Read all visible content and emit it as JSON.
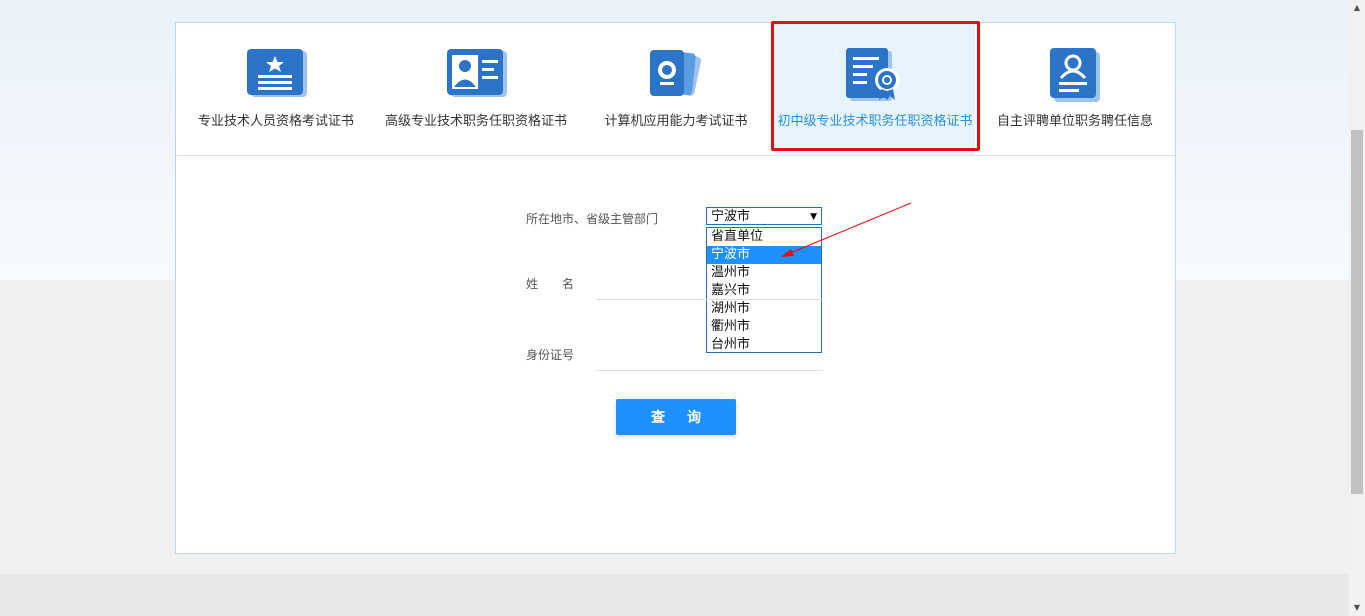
{
  "tabs": [
    {
      "label": "专业技术人员资格考试证书",
      "icon": "id-card-star-icon"
    },
    {
      "label": "高级专业技术职务任职资格证书",
      "icon": "person-card-icon"
    },
    {
      "label": "计算机应用能力考试证书",
      "icon": "certificate-cards-icon"
    },
    {
      "label": "初中级专业技术职务任职资格证书",
      "icon": "document-badge-icon",
      "active": true
    },
    {
      "label": "自主评聘单位职务聘任信息",
      "icon": "person-document-icon"
    }
  ],
  "form": {
    "region_label": "所在地市、省级主管部门",
    "region_value": "宁波市",
    "region_options": [
      "省直单位",
      "宁波市",
      "温州市",
      "嘉兴市",
      "湖州市",
      "衢州市",
      "台州市"
    ],
    "selected_option": "宁波市",
    "name_label": "姓　　名",
    "id_label": "身份证号",
    "query_button": "查询"
  },
  "colors": {
    "accent": "#1e90ff",
    "icon_blue": "#2b74c8",
    "highlight_red": "#e50c12"
  }
}
